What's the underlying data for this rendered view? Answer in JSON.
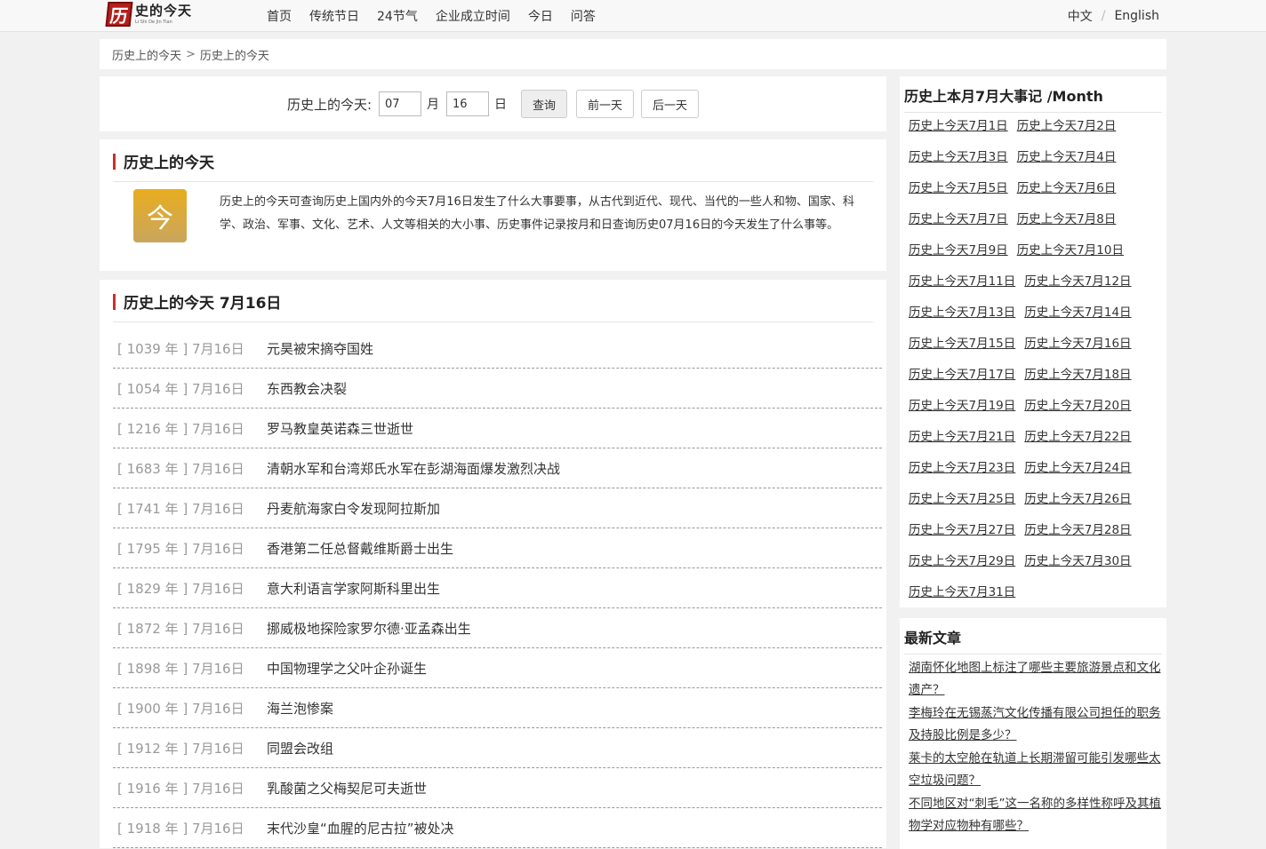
{
  "header": {
    "logo": {
      "mark": "历",
      "text": "史的今天",
      "pinyin": "Li Shi De Jin Tian"
    },
    "nav": [
      "首页",
      "传统节日",
      "24节气",
      "企业成立时间",
      "今日",
      "问答"
    ],
    "lang": {
      "zh": "中文",
      "sep": "/",
      "en": "English"
    }
  },
  "breadcrumb": {
    "items": [
      "历史上的今天",
      "历史上的今天"
    ],
    "sep": ">"
  },
  "query": {
    "label": "历史上的今天:",
    "month": "07",
    "month_unit": "月",
    "day": "16",
    "day_unit": "日",
    "submit": "查询",
    "prev": "前一天",
    "next": "后一天"
  },
  "intro": {
    "title": "历史上的今天",
    "icon": "今",
    "text": "历史上的今天可查询历史上国内外的今天7月16日发生了什么大事要事，从古代到近代、现代、当代的一些人和物、国家、科学、政治、军事、文化、艺术、人文等相关的大小事、历史事件记录按月和日查询历史07月16日的今天发生了什么事等。"
  },
  "events": {
    "title": "历史上的今天 7月16日",
    "items": [
      {
        "date": "[ 1039 年 ] 7月16日",
        "title": "元昊被宋摘夺国姓"
      },
      {
        "date": "[ 1054 年 ] 7月16日",
        "title": "东西教会决裂"
      },
      {
        "date": "[ 1216 年 ] 7月16日",
        "title": "罗马教皇英诺森三世逝世"
      },
      {
        "date": "[ 1683 年 ] 7月16日",
        "title": "清朝水军和台湾郑氏水军在彭湖海面爆发激烈决战"
      },
      {
        "date": "[ 1741 年 ] 7月16日",
        "title": "丹麦航海家白令发现阿拉斯加"
      },
      {
        "date": "[ 1795 年 ] 7月16日",
        "title": "香港第二任总督戴维斯爵士出生"
      },
      {
        "date": "[ 1829 年 ] 7月16日",
        "title": "意大利语言学家阿斯科里出生"
      },
      {
        "date": "[ 1872 年 ] 7月16日",
        "title": "挪威极地探险家罗尔德·亚孟森出生"
      },
      {
        "date": "[ 1898 年 ] 7月16日",
        "title": "中国物理学之父叶企孙诞生"
      },
      {
        "date": "[ 1900 年 ] 7月16日",
        "title": "海兰泡惨案"
      },
      {
        "date": "[ 1912 年 ] 7月16日",
        "title": "同盟会改组"
      },
      {
        "date": "[ 1916 年 ] 7月16日",
        "title": "乳酸菌之父梅契尼可夫逝世"
      },
      {
        "date": "[ 1918 年 ] 7月16日",
        "title": "末代沙皇“血腥的尼古拉”被处决"
      }
    ]
  },
  "sidebar": {
    "month_title": "历史上本月7月大事记 /Month",
    "month_links": [
      "历史上今天7月1日",
      "历史上今天7月2日",
      "历史上今天7月3日",
      "历史上今天7月4日",
      "历史上今天7月5日",
      "历史上今天7月6日",
      "历史上今天7月7日",
      "历史上今天7月8日",
      "历史上今天7月9日",
      "历史上今天7月10日",
      "历史上今天7月11日",
      "历史上今天7月12日",
      "历史上今天7月13日",
      "历史上今天7月14日",
      "历史上今天7月15日",
      "历史上今天7月16日",
      "历史上今天7月17日",
      "历史上今天7月18日",
      "历史上今天7月19日",
      "历史上今天7月20日",
      "历史上今天7月21日",
      "历史上今天7月22日",
      "历史上今天7月23日",
      "历史上今天7月24日",
      "历史上今天7月25日",
      "历史上今天7月26日",
      "历史上今天7月27日",
      "历史上今天7月28日",
      "历史上今天7月29日",
      "历史上今天7月30日",
      "历史上今天7月31日"
    ],
    "articles_title": "最新文章",
    "articles": [
      "湖南怀化地图上标注了哪些主要旅游景点和文化遗产？",
      "李梅玲在无锡蒸汽文化传播有限公司担任的职务及持股比例是多少？",
      "莱卡的太空舱在轨道上长期滞留可能引发哪些太空垃圾问题？",
      "不同地区对“刺毛”这一名称的多样性称呼及其植物学对应物种有哪些？"
    ]
  }
}
